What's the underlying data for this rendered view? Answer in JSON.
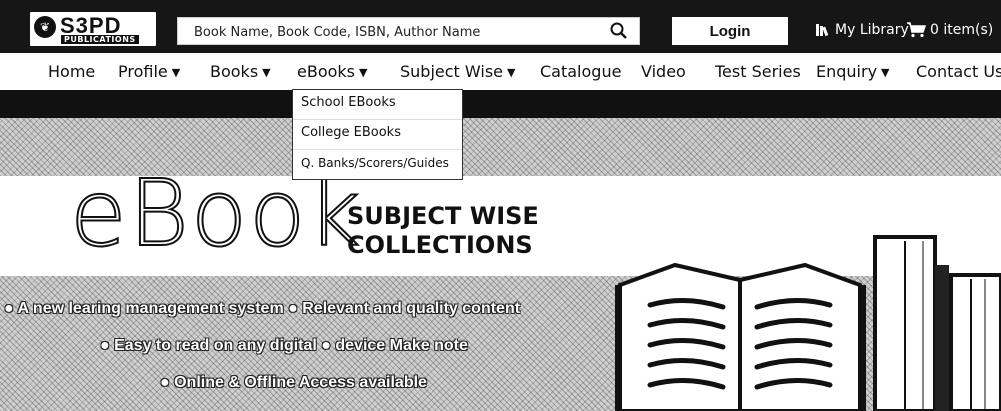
{
  "header": {
    "logo_text": "S3PD",
    "logo_sub": "PUBLICATIONS",
    "search_placeholder": "Book Name, Book Code, ISBN, Author Name",
    "login_label": "Login",
    "my_library_label": "My Library",
    "cart_label": "0 item(s)"
  },
  "nav": {
    "items": [
      {
        "label": "Home"
      },
      {
        "label": "Profile"
      },
      {
        "label": "Books"
      },
      {
        "label": "eBooks"
      },
      {
        "label": "Subject Wise"
      },
      {
        "label": "Catalogue"
      },
      {
        "label": "Video"
      },
      {
        "label": "Test Series"
      },
      {
        "label": "Enquiry"
      },
      {
        "label": "Contact Us"
      }
    ]
  },
  "ebooks_dropdown": {
    "items": [
      {
        "label": "School EBooks"
      },
      {
        "label": "College EBooks"
      },
      {
        "label": "Q. Banks/Scorers/Guides"
      }
    ]
  },
  "banner": {
    "title": "eBook",
    "subtitle_line1": "SUBJECT WISE",
    "subtitle_line2": "COLLECTIONS",
    "bullet1": "● A new learing management system ● Relevant and quality content",
    "bullet2": "● Easy to read on any digital ● device Make note",
    "bullet3": "● Online & Offline Access available"
  },
  "icons": {
    "search": "search-icon",
    "library": "library-icon",
    "cart": "cart-icon",
    "chevron": "chevron-down-icon"
  }
}
